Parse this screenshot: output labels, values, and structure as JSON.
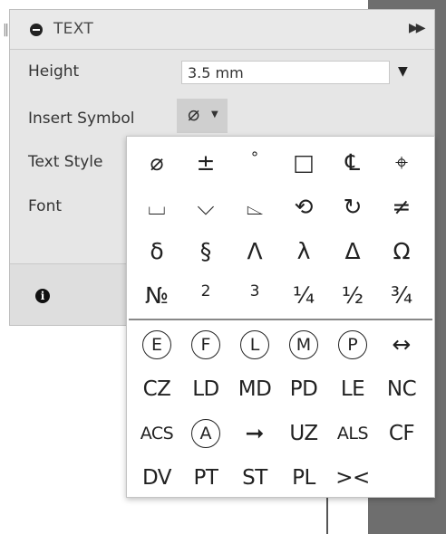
{
  "panel": {
    "title": "TEXT",
    "height_label": "Height",
    "height_value": "3.5 mm",
    "insert_symbol_label": "Insert Symbol",
    "insert_symbol_current": "⌀",
    "text_style_label": "Text Style",
    "font_label": "Font",
    "icons": [
      "collapse-icon",
      "expand-icon",
      "chevron-down-icon",
      "info-icon"
    ]
  },
  "symbols": {
    "top": [
      "⌀",
      "±",
      "°",
      "□",
      "℄",
      "⌖",
      "⌴",
      "⌵",
      "⌳",
      "⟲",
      "↻",
      "≠",
      "δ",
      "§",
      "Λ",
      "λ",
      "Δ",
      "Ω",
      "№",
      "2",
      "3",
      "¼",
      "½",
      "¾"
    ],
    "bottom_circled": [
      "E",
      "F",
      "L",
      "M",
      "P"
    ],
    "bottom": [
      "↔",
      "CZ",
      "LD",
      "MD",
      "PD",
      "LE",
      "NC",
      "ACS",
      "A",
      "➞",
      "UZ",
      "ALS",
      "CF",
      "DV",
      "PT",
      "ST",
      "PL",
      "><"
    ]
  },
  "colors": {
    "panel_bg": "#e6e6e6",
    "popup_bg": "#ffffff",
    "dark_side": "#6e6e6e"
  }
}
